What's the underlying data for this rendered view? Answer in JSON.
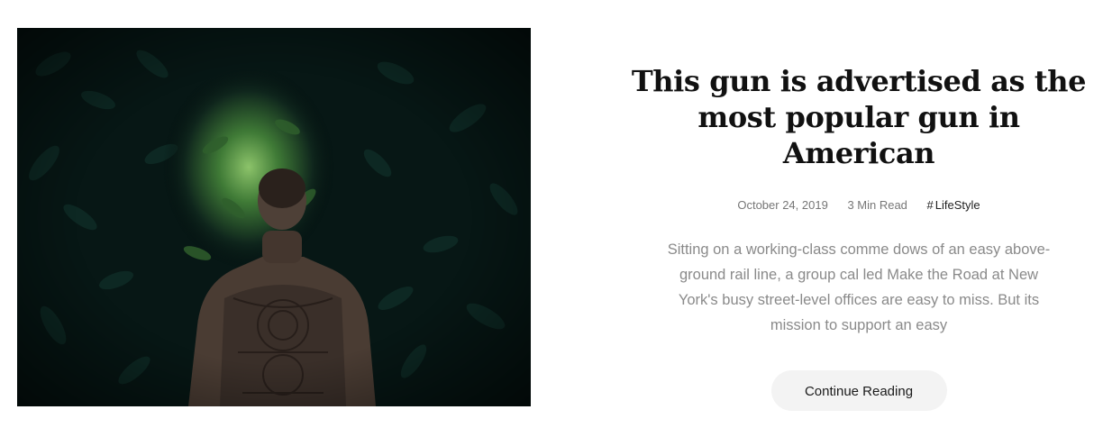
{
  "post": {
    "title_lines": [
      "This gun is advertised as the",
      "most popular gun in American"
    ],
    "date": "October 24, 2019",
    "read_time": "3 Min Read",
    "category_prefix": "#",
    "category": "LifeStyle",
    "excerpt_lines": [
      "Sitting on a working-class comme dows of an easy above-",
      "ground rail line, a group cal led Make the Road at New",
      "York's busy street-level offices are easy to miss. But its",
      "mission to support an easy"
    ],
    "button_label": "Continue Reading"
  },
  "colors": {
    "title": "#111111",
    "meta": "#777777",
    "excerpt": "#8a8a8a",
    "button_bg": "#f3f3f3"
  }
}
